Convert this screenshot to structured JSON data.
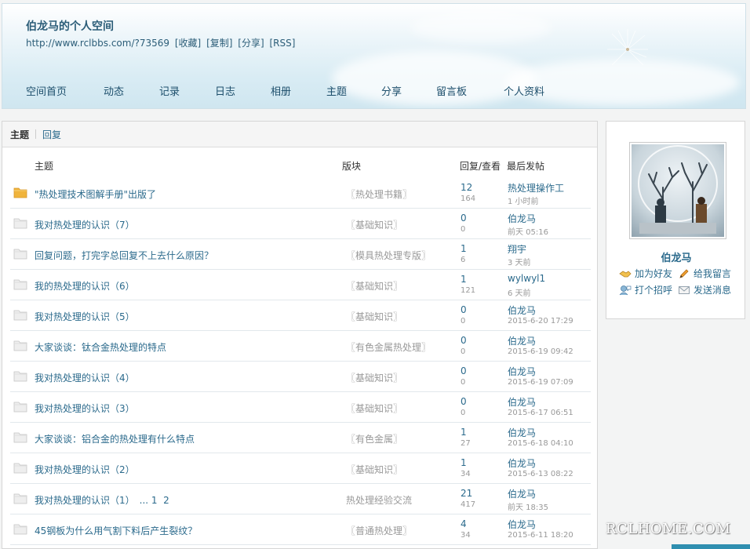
{
  "header": {
    "title": "伯龙马的个人空间",
    "url": "http://www.rclbbs.com/?73569",
    "links": [
      "[收藏]",
      "[复制]",
      "[分享]",
      "[RSS]"
    ]
  },
  "nav": [
    "空间首页",
    "动态",
    "记录",
    "日志",
    "相册",
    "主题",
    "分享",
    "留言板",
    "个人资料"
  ],
  "tabs": {
    "active": "主题",
    "other": "回复"
  },
  "columns": {
    "topic": "主题",
    "forum": "版块",
    "stats": "回复/查看",
    "last": "最后发帖"
  },
  "threads": [
    {
      "title": "\"热处理技术图解手册\"出版了",
      "forum": "〖热处理书籍〗",
      "replies": "12",
      "views": "164",
      "last_user": "热处理操作工",
      "last_time": "1 小时前",
      "hot": true
    },
    {
      "title": "我对热处理的认识（7）",
      "forum": "〖基础知识〗",
      "replies": "0",
      "views": "0",
      "last_user": "伯龙马",
      "last_time": "前天 05:16",
      "hot": false
    },
    {
      "title": "回复问题，打完字总回复不上去什么原因？",
      "forum": "〖模具热处理专版〗",
      "replies": "1",
      "views": "6",
      "last_user": "翔宇",
      "last_time": "3 天前",
      "hot": false
    },
    {
      "title": "我的热处理的认识（6）",
      "forum": "〖基础知识〗",
      "replies": "1",
      "views": "121",
      "last_user": "wylwyl1",
      "last_time": "6 天前",
      "hot": false
    },
    {
      "title": "我对热处理的认识（5）",
      "forum": "〖基础知识〗",
      "replies": "0",
      "views": "0",
      "last_user": "伯龙马",
      "last_time": "2015-6-20 17:29",
      "hot": false
    },
    {
      "title": "大家谈谈：钛合金热处理的特点",
      "forum": "〖有色金属热处理〗",
      "replies": "0",
      "views": "0",
      "last_user": "伯龙马",
      "last_time": "2015-6-19 09:42",
      "hot": false
    },
    {
      "title": "我对热处理的认识（4）",
      "forum": "〖基础知识〗",
      "replies": "0",
      "views": "0",
      "last_user": "伯龙马",
      "last_time": "2015-6-19 07:09",
      "hot": false
    },
    {
      "title": "我对热处理的认识（3）",
      "forum": "〖基础知识〗",
      "replies": "0",
      "views": "0",
      "last_user": "伯龙马",
      "last_time": "2015-6-17 06:51",
      "hot": false
    },
    {
      "title": "大家谈谈：铝合金的热处理有什么特点",
      "forum": "〖有色金属〗",
      "replies": "1",
      "views": "27",
      "last_user": "伯龙马",
      "last_time": "2015-6-18 04:10",
      "hot": false
    },
    {
      "title": "我对热处理的认识（2）",
      "forum": "〖基础知识〗",
      "replies": "1",
      "views": "34",
      "last_user": "伯龙马",
      "last_time": "2015-6-13 08:22",
      "hot": false
    },
    {
      "title": "我对热处理的认识（1）",
      "pages": "... 1  2",
      "forum": "热处理经验交流",
      "replies": "21",
      "views": "417",
      "last_user": "伯龙马",
      "last_time": "前天 18:35",
      "hot": false
    },
    {
      "title": "45钢板为什么用气割下料后产生裂纹？",
      "forum": "〖普通热处理〗",
      "replies": "4",
      "views": "34",
      "last_user": "伯龙马",
      "last_time": "2015-6-11 18:20",
      "hot": false
    }
  ],
  "profile": {
    "name": "伯龙马",
    "actions": [
      "加为好友",
      "给我留言",
      "打个招呼",
      "发送消息"
    ]
  },
  "watermark": "RCLHOME.COM",
  "colors": {
    "link": "#2b6a8c",
    "muted": "#999999",
    "folder_hot": "#f0b43c"
  }
}
